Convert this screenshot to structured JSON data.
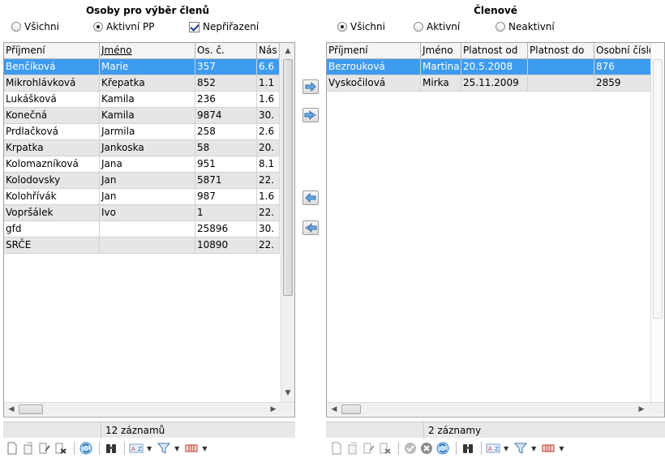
{
  "left": {
    "title": "Osoby pro výběr členů",
    "filters": [
      {
        "label": "Všichni",
        "type": "radio",
        "checked": false
      },
      {
        "label": "Aktivní PP",
        "type": "radio",
        "checked": true
      },
      {
        "label": "Nepřiřazení",
        "type": "checkbox",
        "checked": true
      }
    ],
    "columns": [
      "Příjmení",
      "Jméno",
      "Os. č.",
      "Nás"
    ],
    "rows": [
      [
        "Benčíková",
        "Marie",
        "357",
        "6.6"
      ],
      [
        "Mikrohlávková",
        "Křepatka",
        "852",
        "1.1"
      ],
      [
        "Lukášková",
        "Kamila",
        "236",
        "1.6"
      ],
      [
        "Konečná",
        "Kamila",
        "9874",
        "30."
      ],
      [
        "Prdlačková",
        "Jarmila",
        "258",
        "2.6"
      ],
      [
        "Krpatka",
        "Jankoska",
        "58",
        "20."
      ],
      [
        "Kolomazníková",
        "Jana",
        "951",
        "8.1"
      ],
      [
        "Kolodovsky",
        "Jan",
        "5871",
        "22."
      ],
      [
        "Kolohřívák",
        "Jan",
        "987",
        "1.6"
      ],
      [
        "Vopršálek",
        "Ivo",
        "1",
        "22."
      ],
      [
        "gfd",
        "",
        "25896",
        "30."
      ],
      [
        "SRČE",
        "",
        "10890",
        "22."
      ]
    ],
    "selected_row": 0,
    "status": "12 záznamů"
  },
  "right": {
    "title": "Členové",
    "filters": [
      {
        "label": "Všichni",
        "type": "radio",
        "checked": true
      },
      {
        "label": "Aktivní",
        "type": "radio",
        "checked": false
      },
      {
        "label": "Neaktivní",
        "type": "radio",
        "checked": false
      }
    ],
    "columns": [
      "Příjmení",
      "Jméno",
      "Platnost od",
      "Platnost do",
      "Osobní číslo"
    ],
    "rows": [
      [
        "Bezrouková",
        "Martina",
        "20.5.2008",
        "",
        "876"
      ],
      [
        "Vyskočilová",
        "Mirka",
        "25.11.2009",
        "",
        "2859"
      ]
    ],
    "selected_row": 0,
    "status": "2 záznamy"
  },
  "colors": {
    "selection": "#3d9bf0",
    "alt_row": "#e6e6e6",
    "arrow_blue": "#4a86c8"
  },
  "icons": {
    "move_right": "arrow-right-icon",
    "move_all_right": "double-arrow-right-icon",
    "move_left": "arrow-left-icon",
    "move_all_left": "double-arrow-left-icon"
  }
}
